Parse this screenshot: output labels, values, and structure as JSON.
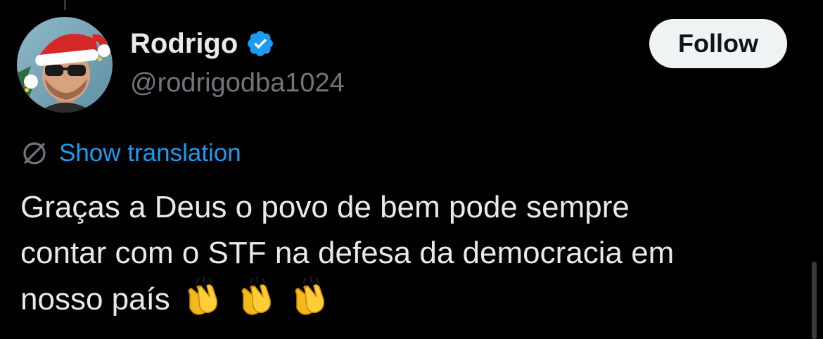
{
  "tweet": {
    "author": {
      "display_name": "Rodrigo",
      "handle": "@rodrigodba1024",
      "verified": true,
      "avatar": "man-with-santa-hat-and-sunglasses"
    },
    "follow_label": "Follow",
    "translation_label": "Show translation",
    "text_lines": [
      "Graças a Deus o povo de bem pode sempre",
      "contar com o STF na defesa da democracia em",
      "nosso país"
    ],
    "emojis": [
      "clapping-hands-icon",
      "clapping-hands-icon",
      "clapping-hands-icon"
    ]
  },
  "colors": {
    "background": "#000000",
    "text": "#e7e9ea",
    "muted": "#71767b",
    "link": "#1d9bf0",
    "follow_bg": "#eff3f4",
    "verified": "#1d9bf0"
  }
}
